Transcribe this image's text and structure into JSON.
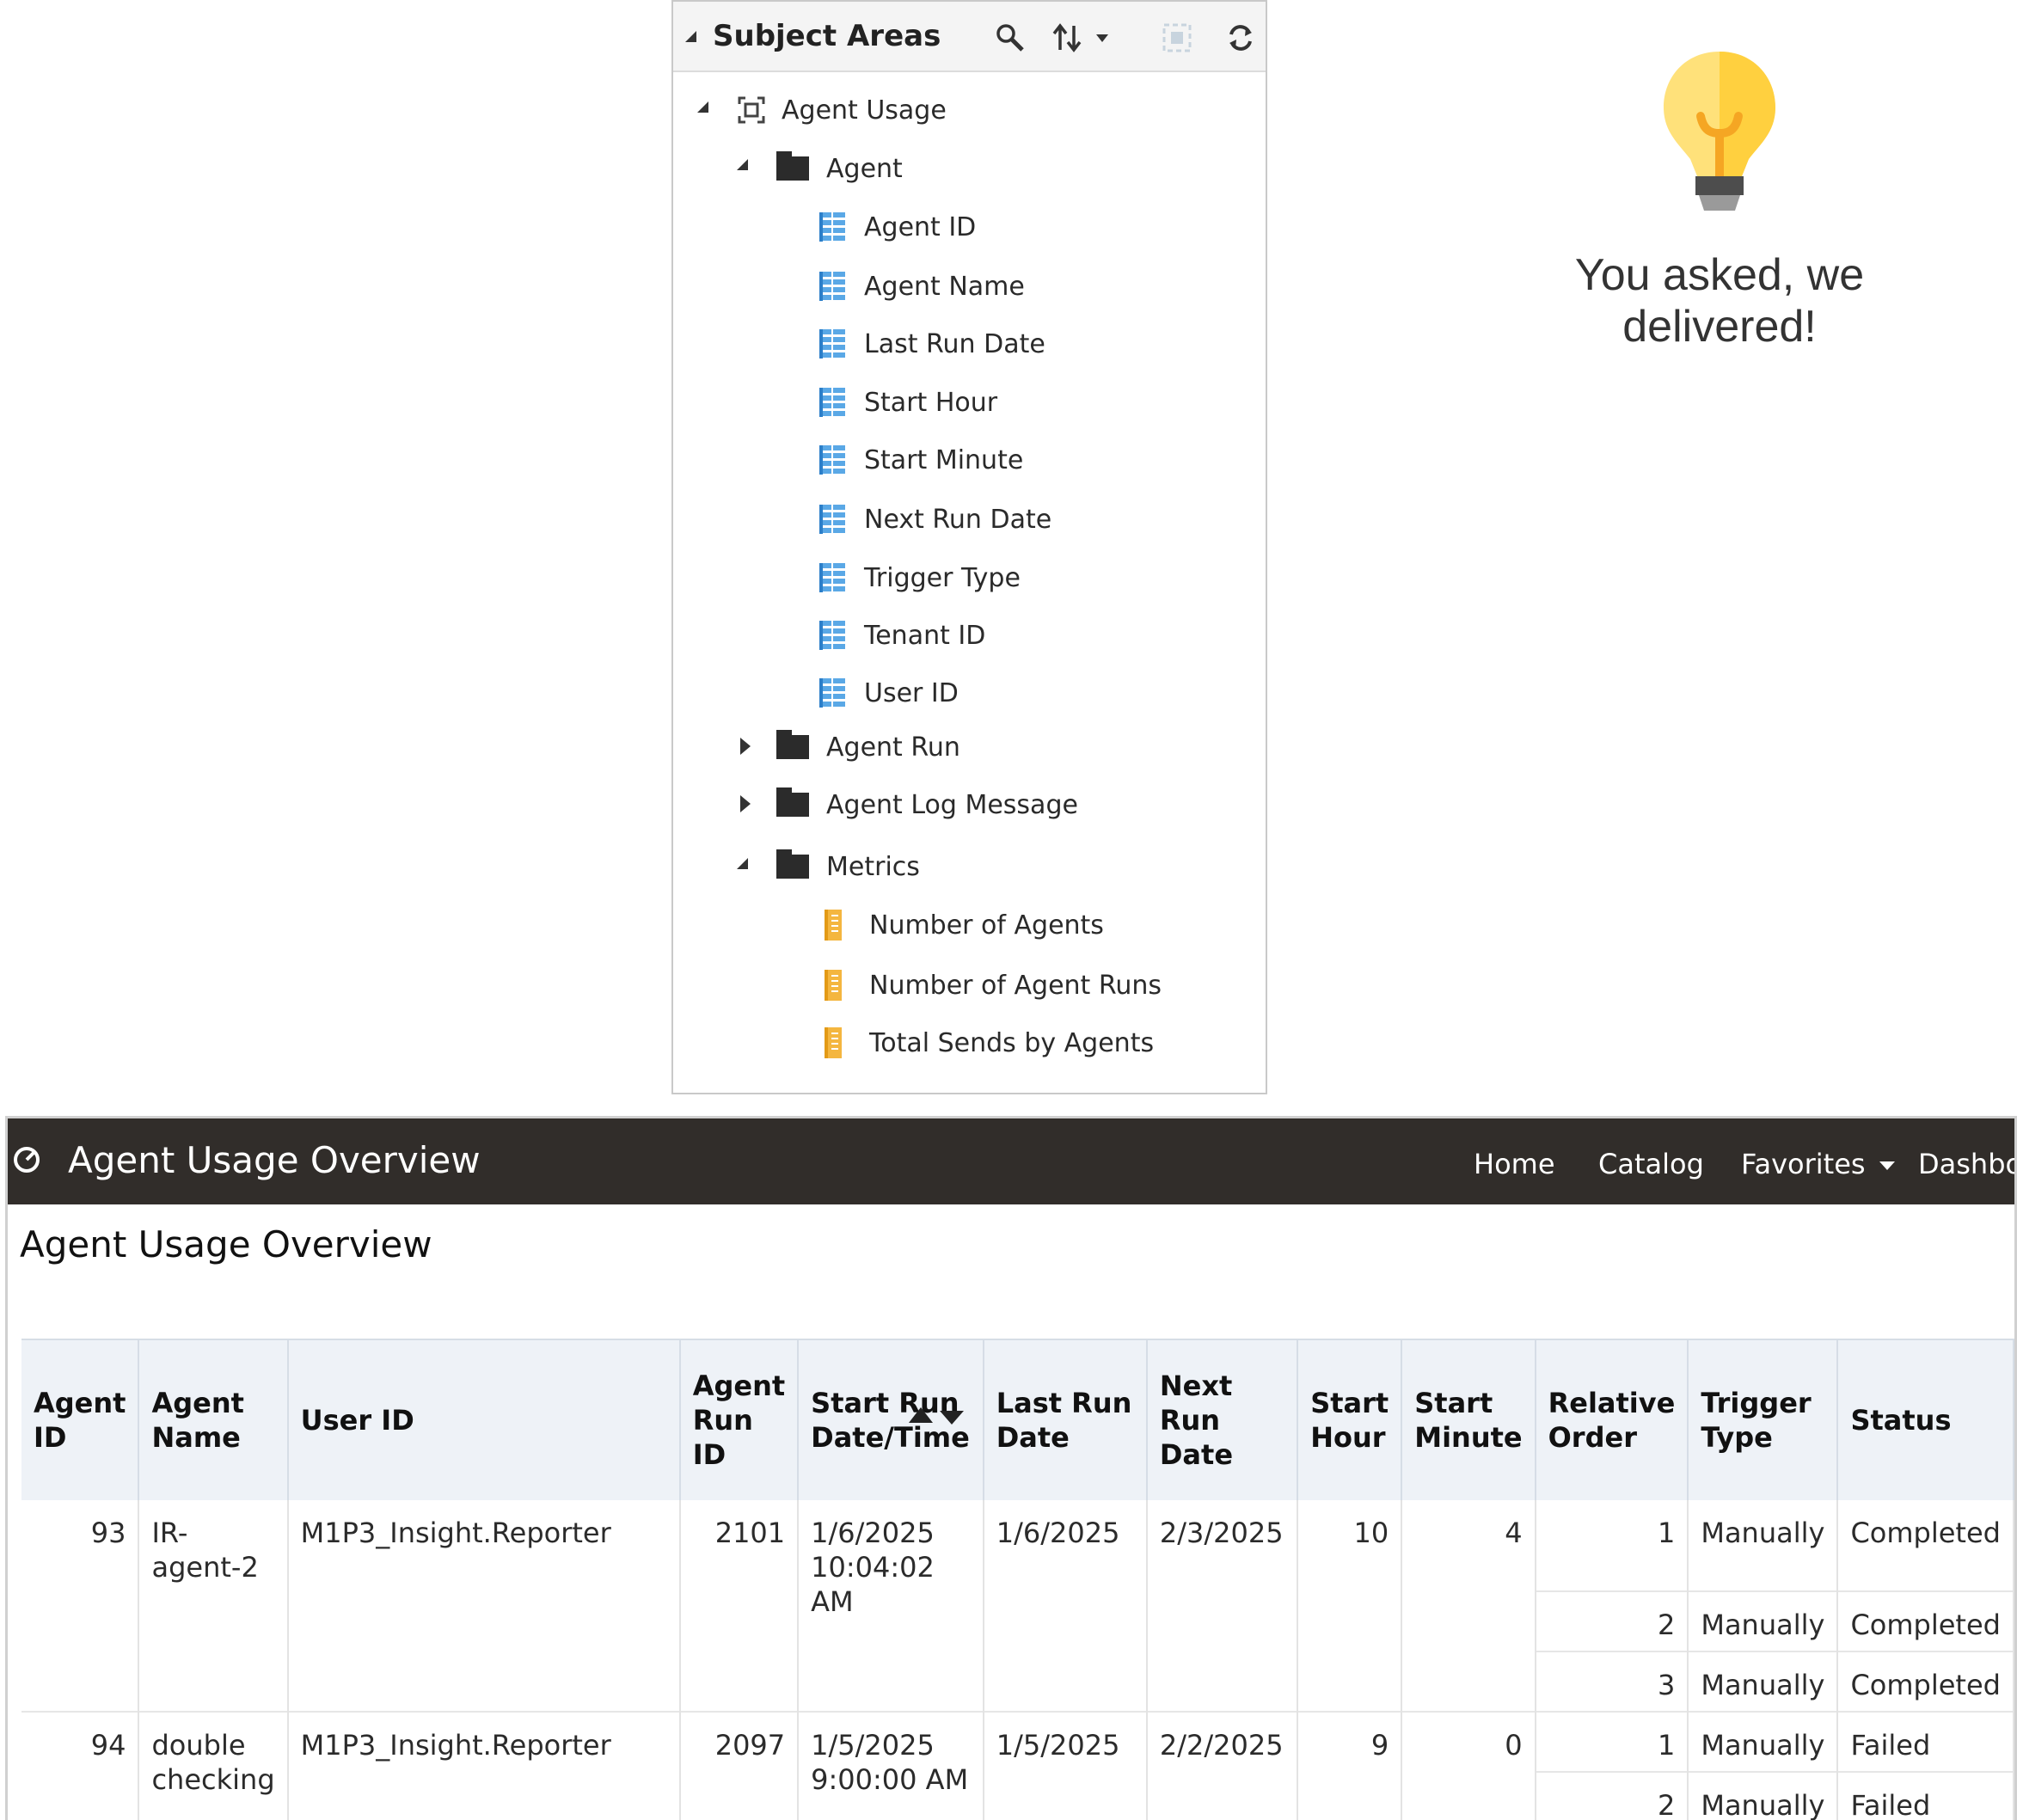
{
  "subject_areas": {
    "title": "Subject Areas",
    "tree": {
      "root": "Agent Usage",
      "agent_folder": "Agent",
      "agent_columns": [
        "Agent ID",
        "Agent Name",
        "Last Run Date",
        "Start Hour",
        "Start Minute",
        "Next Run Date",
        "Trigger Type",
        "Tenant ID",
        "User ID"
      ],
      "agent_run_folder": "Agent Run",
      "agent_log_folder": "Agent Log Message",
      "metrics_folder": "Metrics",
      "metrics": [
        "Number of Agents",
        "Number of Agent Runs",
        "Total Sends by Agents"
      ]
    }
  },
  "promo": {
    "line1": "You asked, we",
    "line2": "delivered!"
  },
  "dashboard": {
    "title": "Agent Usage Overview",
    "nav": {
      "home": "Home",
      "catalog": "Catalog",
      "favorites": "Favorites",
      "dashboards": "Dashbo"
    },
    "heading": "Agent Usage Overview",
    "table": {
      "headers": [
        [
          "Agent",
          "ID"
        ],
        [
          "Agent",
          "Name"
        ],
        [
          "User ID"
        ],
        [
          "Agent",
          "Run",
          "ID"
        ],
        [
          "Start Run",
          "Date/Time"
        ],
        [
          "Last Run",
          "Date"
        ],
        [
          "Next Run",
          "Date"
        ],
        [
          "Start",
          "Hour"
        ],
        [
          "Start",
          "Minute"
        ],
        [
          "Relative",
          "Order"
        ],
        [
          "Trigger",
          "Type"
        ],
        [
          "Status"
        ]
      ],
      "groups": [
        {
          "agent_id": "93",
          "agent_name": [
            "IR-",
            "agent-2"
          ],
          "user_id": "M1P3_Insight.Reporter",
          "run_id": "2101",
          "start_run": [
            "1/6/2025",
            "10:04:02",
            "AM"
          ],
          "last_run": "1/6/2025",
          "next_run": "2/3/2025",
          "start_hour": "10",
          "start_minute": "4",
          "rows": [
            {
              "order": "1",
              "trigger": "Manually",
              "status": "Completed"
            },
            {
              "order": "2",
              "trigger": "Manually",
              "status": "Completed"
            },
            {
              "order": "3",
              "trigger": "Manually",
              "status": "Completed"
            }
          ]
        },
        {
          "agent_id": "94",
          "agent_name": [
            "double",
            "checking"
          ],
          "user_id": "M1P3_Insight.Reporter",
          "run_id": "2097",
          "start_run": [
            "1/5/2025",
            "9:00:00 AM"
          ],
          "last_run": "1/5/2025",
          "next_run": "2/2/2025",
          "start_hour": "9",
          "start_minute": "0",
          "rows": [
            {
              "order": "1",
              "trigger": "Manually",
              "status": "Failed"
            },
            {
              "order": "2",
              "trigger": "Manually",
              "status": "Failed"
            }
          ]
        }
      ]
    }
  }
}
